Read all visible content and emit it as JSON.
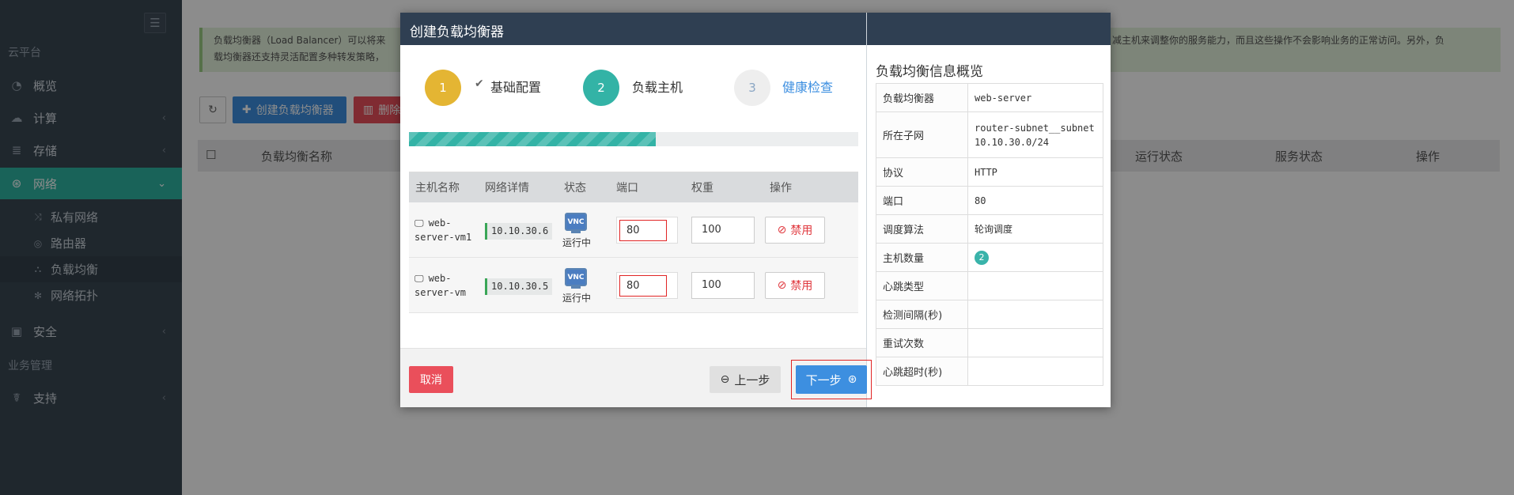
{
  "sidebar": {
    "title": "云平台",
    "section_business": "业务管理",
    "items": [
      {
        "label": "概览",
        "icon": "dashboard-icon"
      },
      {
        "label": "计算",
        "icon": "cloud-icon"
      },
      {
        "label": "存储",
        "icon": "database-icon"
      },
      {
        "label": "网络",
        "icon": "network-icon"
      },
      {
        "label": "安全",
        "icon": "shield-icon"
      },
      {
        "label": "支持",
        "icon": "support-icon"
      }
    ],
    "network_sub": [
      {
        "label": "私有网络"
      },
      {
        "label": "路由器"
      },
      {
        "label": "负载均衡"
      },
      {
        "label": "网络拓扑"
      }
    ]
  },
  "page": {
    "alert_line1": "负载均衡器（Load Balancer）可以将来",
    "alert_line1_right": "减主机来调整你的服务能力，而且这些操作不会影响业务的正常访问。另外，负",
    "alert_line2": "载均衡器还支持灵活配置多种转发策略，",
    "create_button": "创建负载均衡器",
    "delete_button": "删除",
    "table_headers": [
      "负载均衡名称",
      "运行状态",
      "服务状态",
      "操作"
    ]
  },
  "modal": {
    "title": "创建负载均衡器",
    "steps": [
      {
        "num": "1",
        "label": "基础配置",
        "color": "#e4b533"
      },
      {
        "num": "2",
        "label": "负载主机",
        "color": "#33b3a6"
      },
      {
        "num": "3",
        "label": "健康检查",
        "color": "#eeeeee"
      }
    ],
    "progress_percent": 55,
    "host_headers": [
      "主机名称",
      "网络详情",
      "状态",
      "端口",
      "权重",
      "操作"
    ],
    "hosts": [
      {
        "name_line1": "web-",
        "name_line2": "server-vm1",
        "ip": "10.10.30.6",
        "vnc": "VNC",
        "status": "运行中",
        "port": "80",
        "weight": "100",
        "action": "禁用"
      },
      {
        "name_line1": "web-",
        "name_line2": "server-vm",
        "ip": "10.10.30.5",
        "vnc": "VNC",
        "status": "运行中",
        "port": "80",
        "weight": "100",
        "action": "禁用"
      }
    ],
    "cancel": "取消",
    "prev": "上一步",
    "next": "下一步"
  },
  "summary": {
    "title": "负载均衡信息概览",
    "rows": [
      {
        "key": "负载均衡器",
        "value": "web-server"
      },
      {
        "key": "所在子网",
        "value": "router-subnet__subnet",
        "value2": "10.10.30.0/24"
      },
      {
        "key": "协议",
        "value": "HTTP"
      },
      {
        "key": "端口",
        "value": "80"
      },
      {
        "key": "调度算法",
        "value": "轮询调度"
      },
      {
        "key": "主机数量",
        "value": "2"
      },
      {
        "key": "心跳类型",
        "value": ""
      },
      {
        "key": "检测间隔(秒)",
        "value": ""
      },
      {
        "key": "重试次数",
        "value": ""
      },
      {
        "key": "心跳超时(秒)",
        "value": ""
      }
    ]
  }
}
